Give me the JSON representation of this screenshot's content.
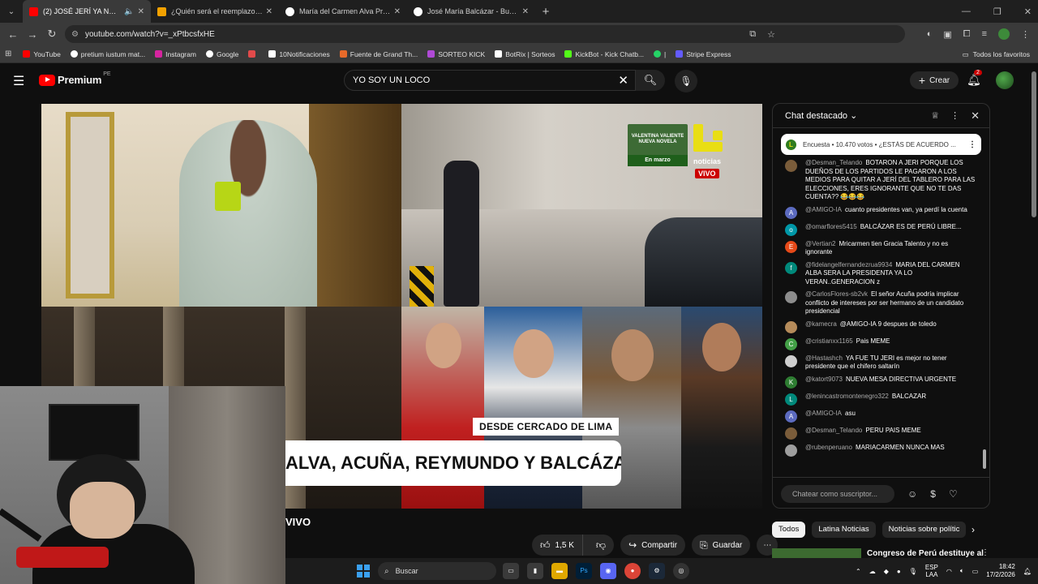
{
  "browser": {
    "tabs": [
      {
        "title": "(2) JOSÉ JERÍ YA NO ES PRE",
        "favicon_color": "#ff0000",
        "active": true,
        "audio": true
      },
      {
        "title": "¿Quién será el reemplazo de Jo",
        "favicon_color": "#f2a100",
        "active": false
      },
      {
        "title": "María del Carmen Alva Prieto -",
        "favicon_color": "#ffffff",
        "active": false
      },
      {
        "title": "José María Balcázar - Buscar co",
        "favicon_color": "#ffffff",
        "active": false
      }
    ],
    "url": "youtube.com/watch?v=_xPtbcsfxHE",
    "bookmarks": [
      {
        "label": "YouTube",
        "color": "#ff0000"
      },
      {
        "label": "pretium iustum mat...",
        "color": "#ffffff"
      },
      {
        "label": "Instagram",
        "color": "#d6249f"
      },
      {
        "label": "Google",
        "color": "#ffffff"
      },
      {
        "label": "",
        "color": "#e24a4a"
      },
      {
        "label": "10Notificaciones",
        "color": "#ffffff"
      },
      {
        "label": "Fuente de Grand Th...",
        "color": "#e86a2a"
      },
      {
        "label": "SORTEO KICK",
        "color": "#b04ad6"
      },
      {
        "label": "BotRix | Sorteos",
        "color": "#ffffff"
      },
      {
        "label": "KickBot - Kick Chatb...",
        "color": "#53fc18"
      },
      {
        "label": "|",
        "color": "#25d366"
      },
      {
        "label": "Stripe Express",
        "color": "#635bff"
      }
    ],
    "all_bookmarks": "Todos los favoritos"
  },
  "youtube": {
    "logo_word": "Premium",
    "country": "PE",
    "search_value": "YO SOY UN LOCO",
    "create_label": "Crear",
    "notifications": "2"
  },
  "video": {
    "promo_line1": "VALENTINA VALIENTE",
    "promo_line2": "NUEVA NOVELA",
    "promo_line3": "En marzo",
    "channel_tag": "noticias",
    "live_tag": "VIVO",
    "lower_third_top": "DESDE CERCADO DE LIMA",
    "lower_third": "ALVA, ACUÑA, REYMUNDO Y BALCÁZAR",
    "title_tail": "VIVO"
  },
  "actions": {
    "likes": "1,5 K",
    "share": "Compartir",
    "save": "Guardar"
  },
  "chat": {
    "header": "Chat destacado",
    "poll": "Encuesta • 10.470 votos • ¿ESTÁS DE ACUERDO ...",
    "input_placeholder": "Chatear como suscriptor...",
    "messages": [
      {
        "author": "@Desman_Telando",
        "text": "BOTARON A JERI PORQUE LOS DUEÑOS DE LOS PARTIDOS LE PAGARON A LOS MEDIOS PARA QUITAR A JERÍ DEL TABLERO PARA LAS ELECCIONES, ERES IGNORANTE QUE NO TE DAS CUENTA?? 😂😂😂",
        "avatar_color": "#7a5c3a",
        "initial": ""
      },
      {
        "author": "@AMIGO-IA",
        "text": "cuanto presidentes van, ya perdí la cuenta",
        "avatar_color": "#5c6bc0",
        "initial": "A"
      },
      {
        "author": "@omarflores5415",
        "text": "BALCÁZAR ES DE PERÚ LIBRE...",
        "avatar_color": "#0097a7",
        "initial": "o"
      },
      {
        "author": "@Vertian2",
        "text": "Mricarmen tien Gracia Talento y no es ignorante",
        "avatar_color": "#e64a19",
        "initial": "E"
      },
      {
        "author": "@fidelangelfernandezrua9934",
        "text": "MARIA DEL CARMEN ALBA SERA LA PRESIDENTA YA LO VERAN..GENERACION z",
        "avatar_color": "#00897b",
        "initial": "f"
      },
      {
        "author": "@CarlosFlores-sb2vk",
        "text": "El señor Acuña podría implicar conflicto de intereses por ser hermano de un candidato presidencial",
        "avatar_color": "#8d8d8d",
        "initial": ""
      },
      {
        "author": "@kamecra",
        "text": "@AMIGO-IA 9 despues de toledo",
        "avatar_color": "#b58b5a",
        "initial": ""
      },
      {
        "author": "@cristianxx1165",
        "text": "Pais MEME",
        "avatar_color": "#43a047",
        "initial": "C"
      },
      {
        "author": "@Hastashch",
        "text": "YA FUE TU JERI es mejor no tener presidente que el chifero saltarín",
        "avatar_color": "#cfcfcf",
        "initial": ""
      },
      {
        "author": "@katort9073",
        "text": "NUEVA MESA DIRECTIVA URGENTE",
        "avatar_color": "#2e7d32",
        "initial": "K"
      },
      {
        "author": "@lenincastromontenegro322",
        "text": "BALCAZAR",
        "avatar_color": "#00897b",
        "initial": "L"
      },
      {
        "author": "@AMIGO-IA",
        "text": "asu",
        "avatar_color": "#5c6bc0",
        "initial": "A"
      },
      {
        "author": "@Desman_Telando",
        "text": "PERU PAIS MEME",
        "avatar_color": "#7a5c3a",
        "initial": ""
      },
      {
        "author": "@rubenperuano",
        "text": "MARIACARMEN NUNCA MAS",
        "avatar_color": "#9e9e9e",
        "initial": ""
      }
    ]
  },
  "chips": [
    "Todos",
    "Latina Noticias",
    "Noticias sobre polític"
  ],
  "recommendation": {
    "title": "Congreso de Perú destituye al"
  },
  "taskbar": {
    "search": "Buscar",
    "lang_top": "ESP",
    "lang_bottom": "LAA",
    "time": "18:42",
    "date": "17/2/2026"
  }
}
